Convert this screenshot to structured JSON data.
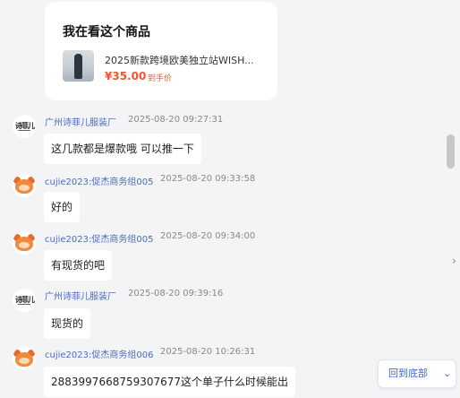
{
  "product_card": {
    "heading": "我在看这个商品",
    "name": "2025新款跨境欧美独立站WISH...",
    "price": "¥35.00",
    "price_note": "到手价"
  },
  "messages": [
    {
      "sender": "广州诗菲儿服装厂",
      "time": "2025-08-20 09:27:31",
      "text": "这几款都是爆款哦 可以推一下",
      "avatar": "shop-logo-icon"
    },
    {
      "sender": "cujie2023:促杰商务组005",
      "time": "2025-08-20 09:33:58",
      "text": "好的",
      "avatar": "mascot-avatar-icon"
    },
    {
      "sender": "cujie2023:促杰商务组005",
      "time": "2025-08-20 09:34:00",
      "text": "有现货的吧",
      "avatar": "mascot-avatar-icon"
    },
    {
      "sender": "广州诗菲儿服装厂",
      "time": "2025-08-20 09:39:16",
      "text": "现货的",
      "avatar": "shop-logo-icon"
    },
    {
      "sender": "cujie2023:促杰商务组006",
      "time": "2025-08-20 10:26:31",
      "text": "2883997668759307677这个单子什么时候能出",
      "avatar": "mascot-avatar-icon"
    }
  ],
  "shop_logo_text": "诗菲儿",
  "back_to_bottom": {
    "label": "回到底部",
    "icon": "chevron-down-icon"
  },
  "side_arrow_icon": "chevron-right-icon"
}
